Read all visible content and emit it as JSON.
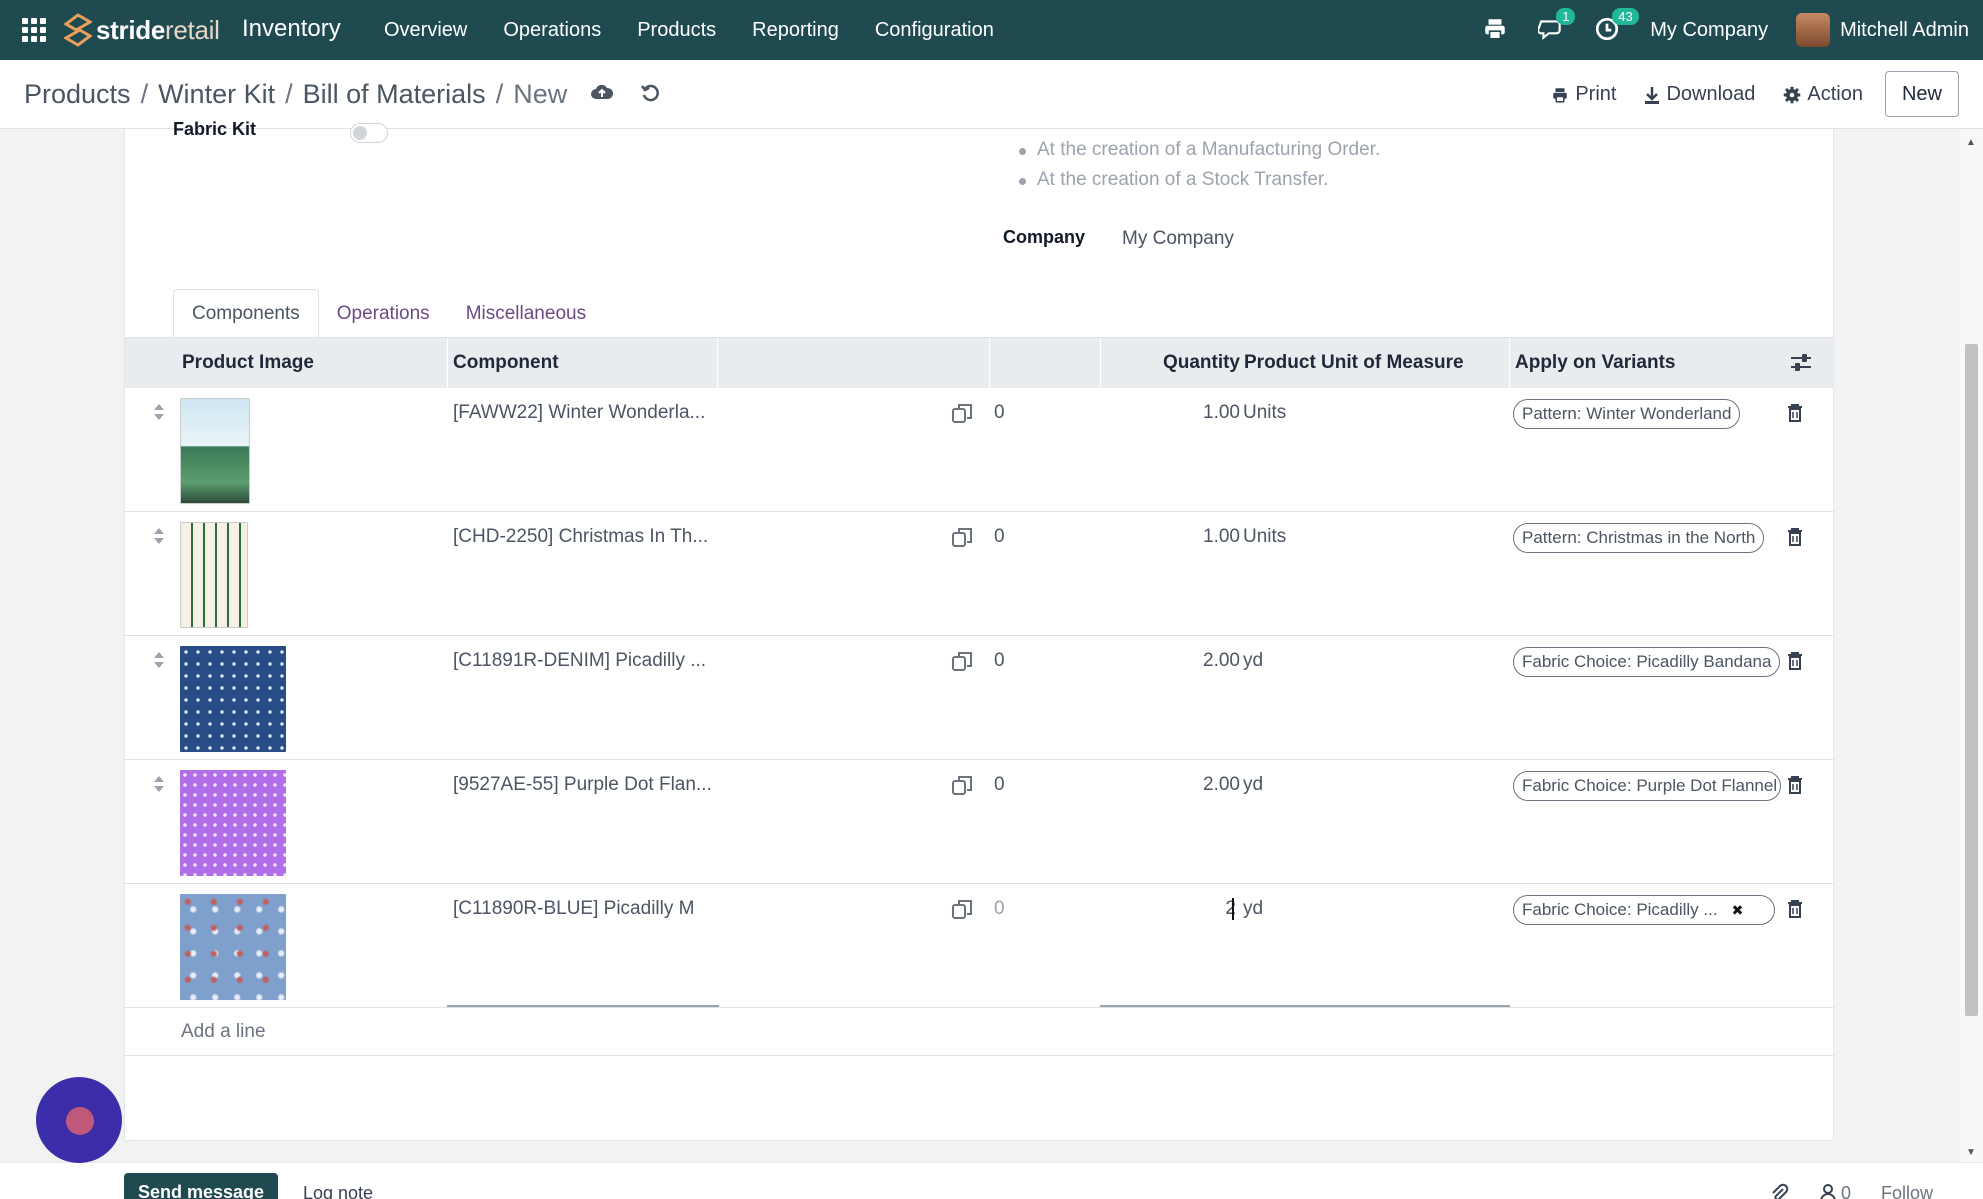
{
  "navbar": {
    "brand_strong": "stride",
    "brand_light": "retail",
    "app_name": "Inventory",
    "menu": [
      "Overview",
      "Operations",
      "Products",
      "Reporting",
      "Configuration"
    ],
    "messages_badge": "1",
    "activities_badge": "43",
    "company": "My Company",
    "user": "Mitchell Admin"
  },
  "breadcrumb": {
    "items": [
      "Products",
      "Winter Kit",
      "Bill of Materials"
    ],
    "current": "New"
  },
  "actions": {
    "print": "Print",
    "download": "Download",
    "action": "Action",
    "new": "New"
  },
  "form": {
    "fabric_kit_label": "Fabric Kit",
    "bullets": [
      "At the creation of a Manufacturing Order.",
      "At the creation of a Stock Transfer."
    ],
    "company_label": "Company",
    "company_value": "My Company"
  },
  "tabs": [
    "Components",
    "Operations",
    "Miscellaneous"
  ],
  "table": {
    "headers": {
      "image": "Product Image",
      "component": "Component",
      "quantity": "Quantity",
      "uom": "Product Unit of Measure",
      "variants": "Apply on Variants"
    },
    "rows": [
      {
        "component": "[FAWW22] Winter Wonderla...",
        "count": "0",
        "quantity": "1.00",
        "uom": "Units",
        "variant": "Pattern: Winter Wonderland",
        "thumb": "winter"
      },
      {
        "component": "[CHD-2250] Christmas In Th...",
        "count": "0",
        "quantity": "1.00",
        "uom": "Units",
        "variant": "Pattern: Christmas in the North",
        "thumb": "christmas"
      },
      {
        "component": "[C11891R-DENIM] Picadilly ...",
        "count": "0",
        "quantity": "2.00",
        "uom": "yd",
        "variant": "Fabric Choice: Picadilly Bandana",
        "thumb": "denim"
      },
      {
        "component": "[9527AE-55] Purple Dot Flan...",
        "count": "0",
        "quantity": "2.00",
        "uom": "yd",
        "variant": "Fabric Choice: Purple Dot Flannel",
        "thumb": "purple"
      },
      {
        "component": "[C11890R-BLUE] Picadilly M",
        "count": "0",
        "quantity": "2",
        "uom": "yd",
        "variant": "Fabric Choice: Picadilly ...",
        "thumb": "blue"
      }
    ],
    "add_line": "Add a line"
  },
  "chatter": {
    "send_message": "Send message",
    "log_note": "Log note",
    "followers": "0",
    "follow": "Follow"
  },
  "colors": {
    "navbar": "#1f4a4f",
    "accent_link": "#6b4a86",
    "badge": "#21b799"
  }
}
